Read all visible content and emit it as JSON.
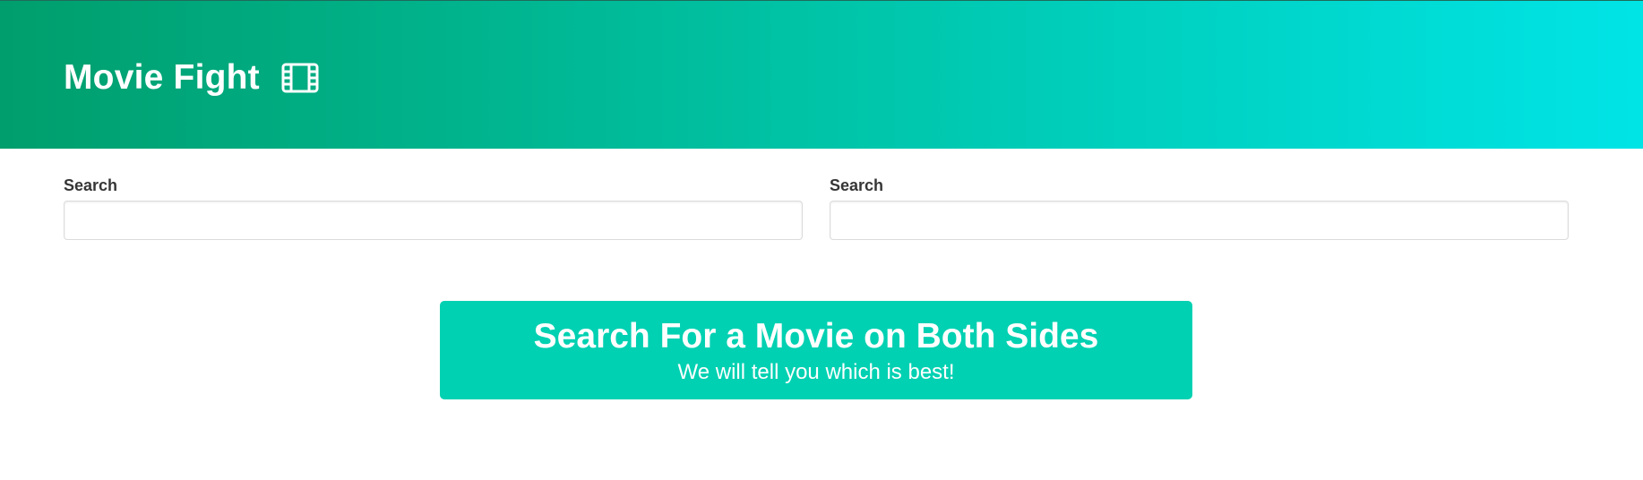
{
  "header": {
    "title": "Movie Fight",
    "icon": "film-icon",
    "gradient": [
      "#009e6c",
      "#00c4a7",
      "#00e4e6"
    ]
  },
  "search": {
    "left": {
      "label": "Search",
      "value": "",
      "placeholder": ""
    },
    "right": {
      "label": "Search",
      "value": "",
      "placeholder": ""
    }
  },
  "notification": {
    "title": "Search For a Movie on Both Sides",
    "subtitle": "We will tell you which is best!",
    "color": "#00d1b2"
  }
}
